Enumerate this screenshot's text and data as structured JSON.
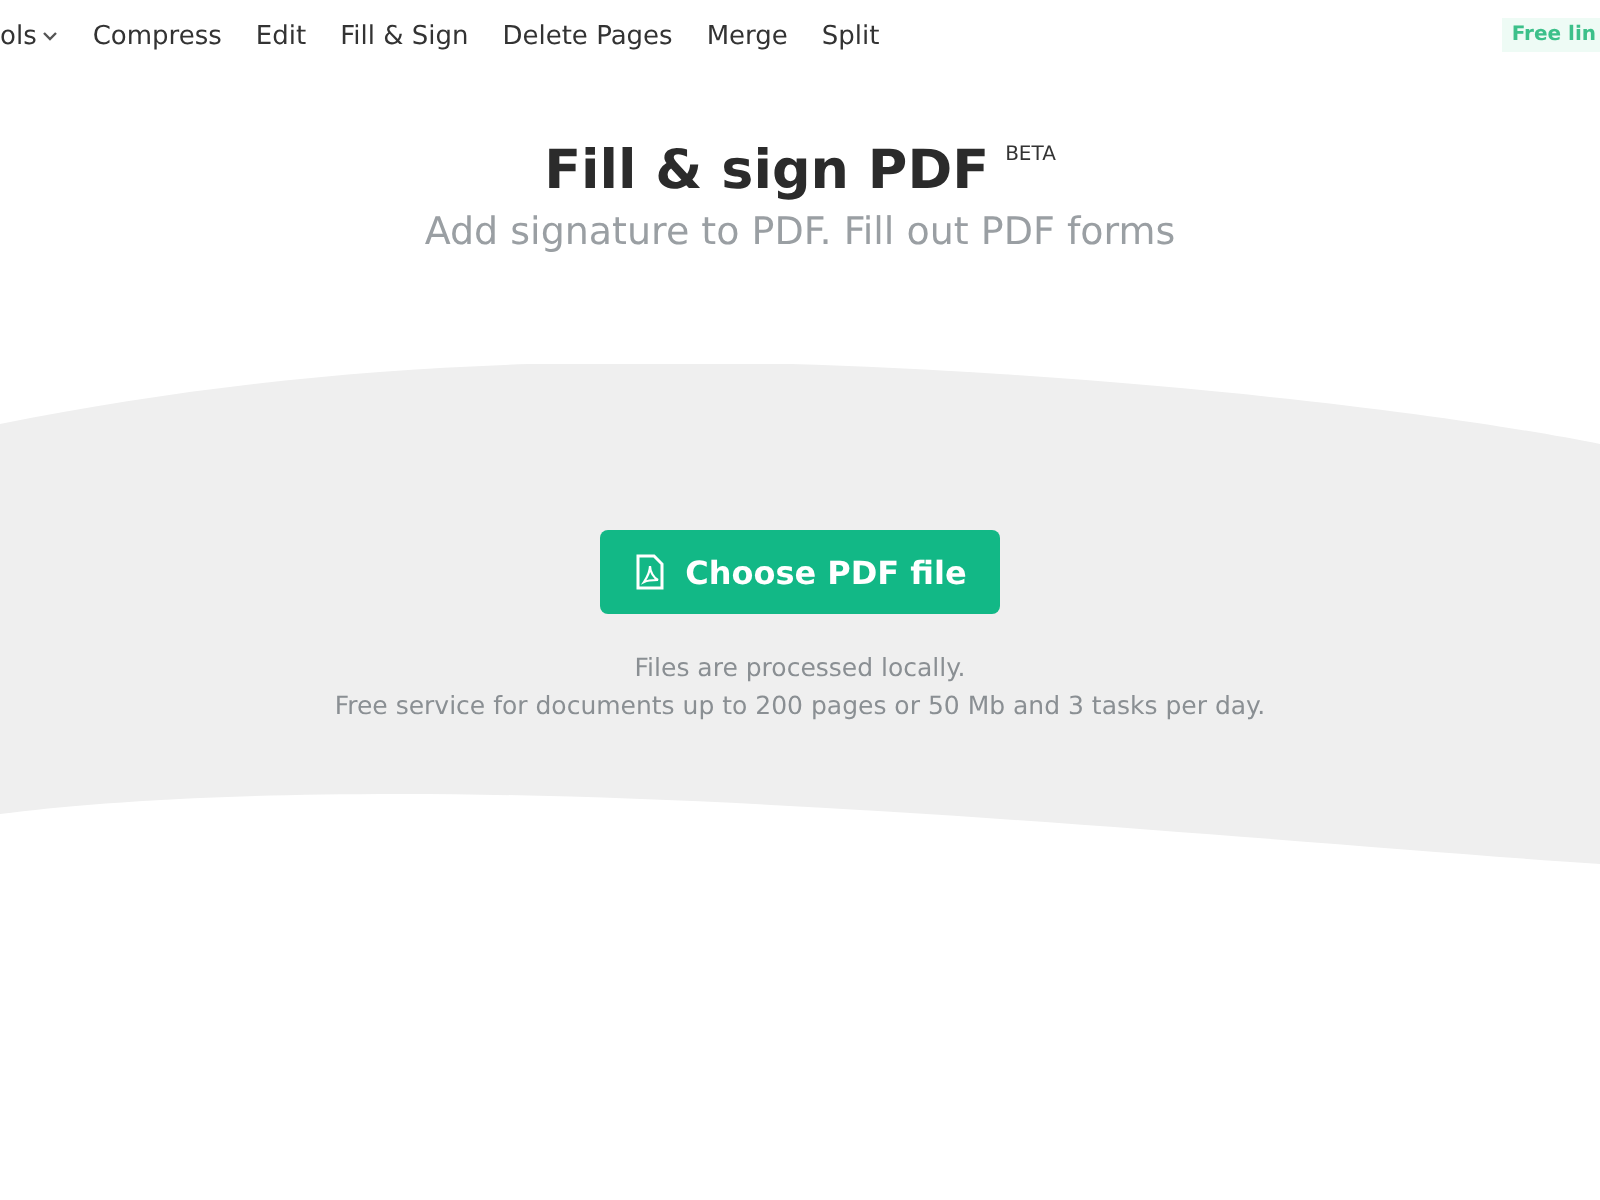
{
  "nav": {
    "items": [
      {
        "label": "ols",
        "kind": "dropdown"
      },
      {
        "label": "Compress",
        "kind": "link"
      },
      {
        "label": "Edit",
        "kind": "link"
      },
      {
        "label": "Fill & Sign",
        "kind": "link"
      },
      {
        "label": "Delete Pages",
        "kind": "link"
      },
      {
        "label": "Merge",
        "kind": "link"
      },
      {
        "label": "Split",
        "kind": "link"
      }
    ],
    "badge": "Free lin"
  },
  "hero": {
    "title": "Fill & sign PDF",
    "title_tag": "BETA",
    "subtitle": "Add signature to PDF. Fill out PDF forms"
  },
  "upload": {
    "button": "Choose PDF file",
    "notes": [
      "Files are processed locally.",
      "Free service for documents up to 200 pages or 50 Mb and 3 tasks per day."
    ]
  }
}
